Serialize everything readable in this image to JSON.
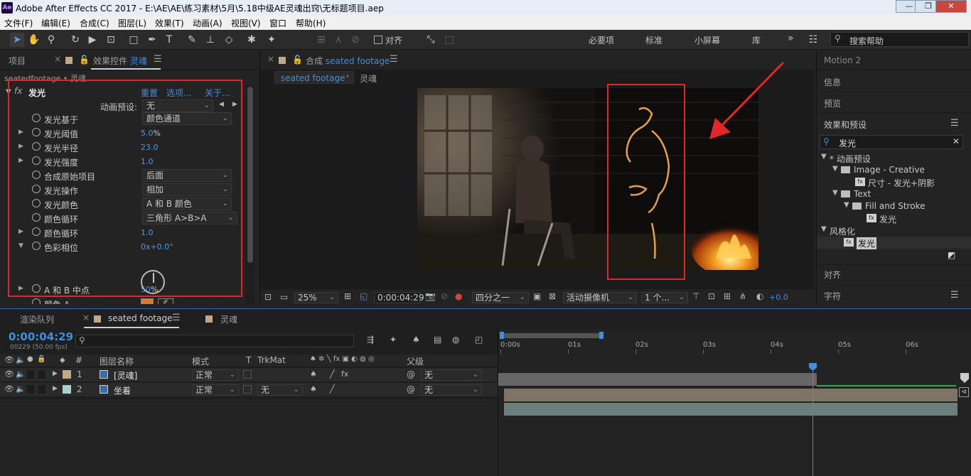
{
  "window": {
    "title": "Adobe After Effects CC 2017 - E:\\AE\\AE\\练习素材\\5月\\5.18中级AE灵魂出窍\\无标题项目.aep",
    "app_icon": "Ae",
    "min": "—",
    "max": "❐",
    "close": "✕"
  },
  "menu": [
    "文件(F)",
    "编辑(E)",
    "合成(C)",
    "图层(L)",
    "效果(T)",
    "动画(A)",
    "视图(V)",
    "窗口",
    "帮助(H)"
  ],
  "toolbar": {
    "snap_label": "对齐",
    "workspaces": [
      "必要项",
      "标准",
      "小屏幕",
      "库"
    ],
    "more": "»",
    "help_placeholder": "搜索帮助"
  },
  "project_panel": {
    "tab_project": "项目",
    "tab_effects_prefix": "效果控件",
    "tab_effects_layer": "灵魂",
    "breadcrumb": "seatedfootage • 灵魂",
    "effect": {
      "fx": "fx",
      "name": "发光",
      "reset": "重置",
      "options": "选项...",
      "about": "关于...",
      "preset_label": "动画预设:",
      "preset_value": "无",
      "props": [
        {
          "label": "发光基于",
          "type": "dd",
          "value": "颜色通道",
          "tri": false
        },
        {
          "label": "发光阈值",
          "type": "num",
          "value": "5.0",
          "unit": "%",
          "tri": true
        },
        {
          "label": "发光半径",
          "type": "num",
          "value": "23.0",
          "tri": true
        },
        {
          "label": "发光强度",
          "type": "num",
          "value": "1.0",
          "tri": true
        },
        {
          "label": "合成原始项目",
          "type": "dd",
          "value": "后面",
          "tri": false
        },
        {
          "label": "发光操作",
          "type": "dd",
          "value": "相加",
          "tri": false
        },
        {
          "label": "发光颜色",
          "type": "dd",
          "value": "A 和 B 颜色",
          "tri": false
        },
        {
          "label": "颜色循环",
          "type": "dd",
          "value": "三角形 A>B>A",
          "tri": false
        },
        {
          "label": "颜色循环",
          "type": "num",
          "value": "1.0",
          "tri": true
        },
        {
          "label": "色彩相位",
          "type": "num",
          "value": "0x+0.0°",
          "tri": true,
          "open": true
        },
        {
          "label": "A 和 B 中点",
          "type": "num",
          "value": "50",
          "unit": "%",
          "tri": true
        },
        {
          "label": "颜色 A",
          "type": "color",
          "value": "",
          "tri": false
        }
      ],
      "color_a": "#e07a2a"
    }
  },
  "comp_panel": {
    "tab_prefix": "合成",
    "tab_name": "seated footage",
    "subtab_active": "seated footage",
    "subtab_other": "灵魂",
    "footer": {
      "zoom": "25%",
      "timecode": "0:00:04:29",
      "resolution": "四分之一",
      "camera": "活动摄像机",
      "views": "1 个...",
      "exposure": "+0.0"
    }
  },
  "right_panel": {
    "items": [
      "Motion 2",
      "信息",
      "预览",
      "效果和预设"
    ],
    "search_value": "发光",
    "tree": [
      {
        "label": "* 动画预设",
        "level": 0,
        "kind": "group"
      },
      {
        "label": "Image - Creative",
        "level": 1,
        "kind": "folder"
      },
      {
        "label": "尺寸 - 发光+阴影",
        "level": 2,
        "kind": "preset"
      },
      {
        "label": "Text",
        "level": 1,
        "kind": "folder"
      },
      {
        "label": "Fill and Stroke",
        "level": 2,
        "kind": "folder"
      },
      {
        "label": "发光",
        "level": 3,
        "kind": "preset"
      },
      {
        "label": "风格化",
        "level": 0,
        "kind": "group"
      },
      {
        "label": "发光",
        "level": 1,
        "kind": "effect"
      }
    ],
    "align": "对齐",
    "character": "字符"
  },
  "timeline": {
    "tab_render": "渲染队列",
    "tab_comp": "seated footage",
    "tab_comp2": "灵魂",
    "timecode": "0:00:04:29",
    "frames": "00229 (50.00 fps)",
    "search_placeholder": "",
    "headers": {
      "num": "#",
      "name": "图层名称",
      "mode": "模式",
      "t": "T",
      "trkmat": "TrkMat",
      "parent": "父级"
    },
    "layers": [
      {
        "num": "1",
        "name": "[灵魂]",
        "mode": "正常",
        "trkmat": "",
        "parent": "无",
        "label_color": "#bfa98a"
      },
      {
        "num": "2",
        "name": "坐着",
        "mode": "正常",
        "trkmat": "无",
        "parent": "无",
        "label_color": "#a8d0cc"
      }
    ],
    "ruler": [
      "0:00s",
      "01s",
      "02s",
      "03s",
      "04s",
      "05s",
      "06s"
    ],
    "playhead_seconds": 4.58
  }
}
